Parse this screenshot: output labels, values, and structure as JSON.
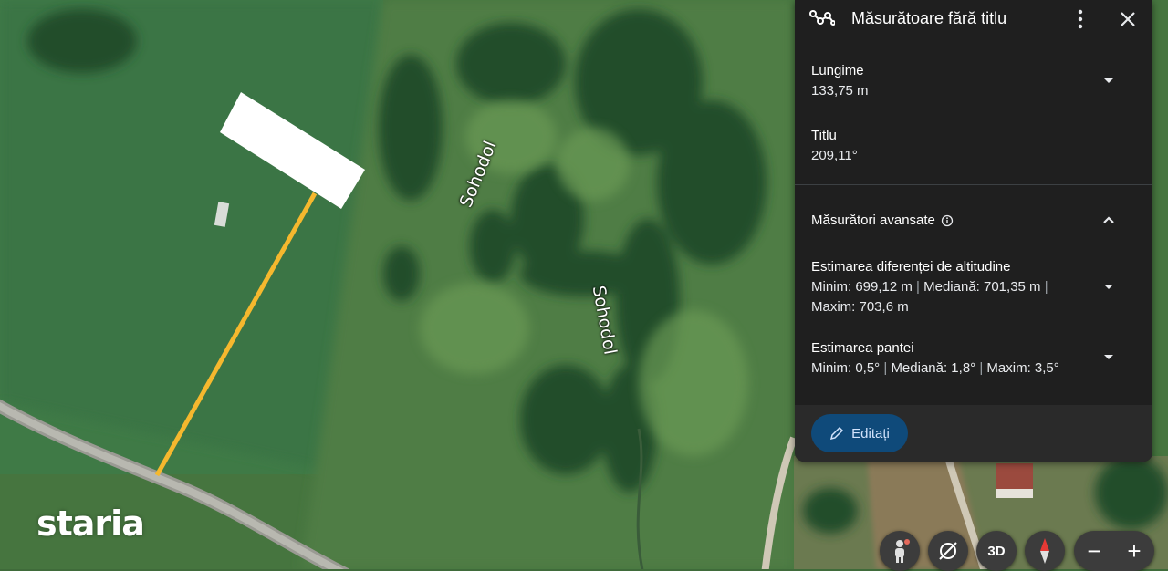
{
  "map": {
    "labels": [
      "Sohodol",
      "Sohodol"
    ],
    "brand": "staria"
  },
  "panel": {
    "title": "Măsurătoare fără titlu",
    "header_icon": "measure-path-icon",
    "length": {
      "label": "Lungime",
      "value": "133,75 m"
    },
    "heading": {
      "label": "Titlu",
      "value": "209,11°"
    },
    "advanced": {
      "title": "Măsurători avansate",
      "elevation": {
        "title": "Estimarea diferenței de altitudine",
        "min": "Minim: 699,12 m",
        "median": "Mediană: 701,35 m",
        "max": "Maxim: 703,6 m"
      },
      "slope": {
        "title": "Estimarea pantei",
        "min": "Minim: 0,5°",
        "median": "Mediană: 1,8°",
        "max": "Maxim: 3,5°"
      }
    },
    "edit_label": "Editați",
    "separator": "|"
  },
  "controls": {
    "three_d": "3D",
    "zoom_out": "−",
    "zoom_in": "+"
  },
  "colors": {
    "panel_bg": "#1f1f1f",
    "measure_line": "#f5b82e",
    "edit_button": "#0f4a7a"
  }
}
